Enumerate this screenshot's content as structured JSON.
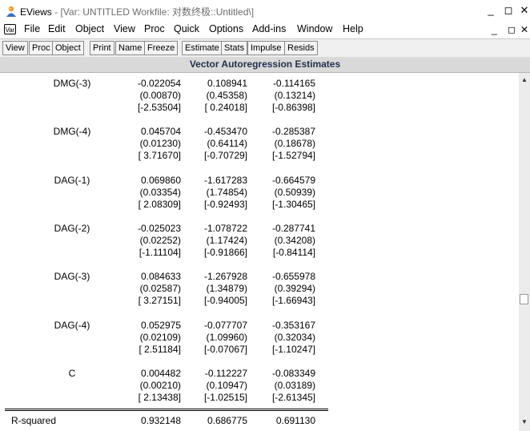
{
  "window": {
    "app": "EViews",
    "title_detail": "- [Var: UNTITLED    Workfile: 对数终极::Untitled\\]",
    "controls": {
      "minimize": "_",
      "restore": "◻",
      "close": "✕"
    }
  },
  "menubar": {
    "var_icon": "Var",
    "items": [
      "File",
      "Edit",
      "Object",
      "View",
      "Proc",
      "Quick",
      "Options",
      "Add-ins",
      "Window",
      "Help"
    ],
    "mdi_controls": {
      "minimize": "_",
      "restore": "◻",
      "close": "✕"
    }
  },
  "toolbar": {
    "buttons": [
      "View",
      "Proc",
      "Object",
      "Print",
      "Name",
      "Freeze",
      "Estimate",
      "Stats",
      "Impulse",
      "Resids"
    ]
  },
  "header": {
    "title": "Vector Autoregression Estimates"
  },
  "table": {
    "rows": [
      {
        "name": "DMG(-3)",
        "coef": [
          "-0.022054",
          "0.108941",
          "-0.114165"
        ],
        "se": [
          "(0.00870)",
          "(0.45358)",
          "(0.13214)"
        ],
        "t": [
          "[-2.53504]",
          "[ 0.24018]",
          "[-0.86398]"
        ]
      },
      {
        "name": "DMG(-4)",
        "coef": [
          "0.045704",
          "-0.453470",
          "-0.285387"
        ],
        "se": [
          "(0.01230)",
          "(0.64114)",
          "(0.18678)"
        ],
        "t": [
          "[ 3.71670]",
          "[-0.70729]",
          "[-1.52794]"
        ]
      },
      {
        "name": "DAG(-1)",
        "coef": [
          "0.069860",
          "-1.617283",
          "-0.664579"
        ],
        "se": [
          "(0.03354)",
          "(1.74854)",
          "(0.50939)"
        ],
        "t": [
          "[ 2.08309]",
          "[-0.92493]",
          "[-1.30465]"
        ]
      },
      {
        "name": "DAG(-2)",
        "coef": [
          "-0.025023",
          "-1.078722",
          "-0.287741"
        ],
        "se": [
          "(0.02252)",
          "(1.17424)",
          "(0.34208)"
        ],
        "t": [
          "[-1.11104]",
          "[-0.91866]",
          "[-0.84114]"
        ]
      },
      {
        "name": "DAG(-3)",
        "coef": [
          "0.084633",
          "-1.267928",
          "-0.655978"
        ],
        "se": [
          "(0.02587)",
          "(1.34879)",
          "(0.39294)"
        ],
        "t": [
          "[ 3.27151]",
          "[-0.94005]",
          "[-1.66943]"
        ]
      },
      {
        "name": "DAG(-4)",
        "coef": [
          "0.052975",
          "-0.077707",
          "-0.353167"
        ],
        "se": [
          "(0.02109)",
          "(1.09960)",
          "(0.32034)"
        ],
        "t": [
          "[ 2.51184]",
          "[-0.07067]",
          "[-1.10247]"
        ]
      },
      {
        "name": "C",
        "coef": [
          "0.004482",
          "-0.112227",
          "-0.083349"
        ],
        "se": [
          "(0.00210)",
          "(0.10947)",
          "(0.03189)"
        ],
        "t": [
          "[ 2.13438]",
          "[-1.02515]",
          "[-2.61345]"
        ]
      }
    ],
    "stats": [
      {
        "label": "R-squared",
        "values": [
          "0.932148",
          "0.686775",
          "0.691130"
        ]
      }
    ]
  },
  "colors": {
    "header_bg": "#d9d9d9",
    "toolbar_bg": "#f0f0f0",
    "header_text": "#1f2f4f"
  }
}
